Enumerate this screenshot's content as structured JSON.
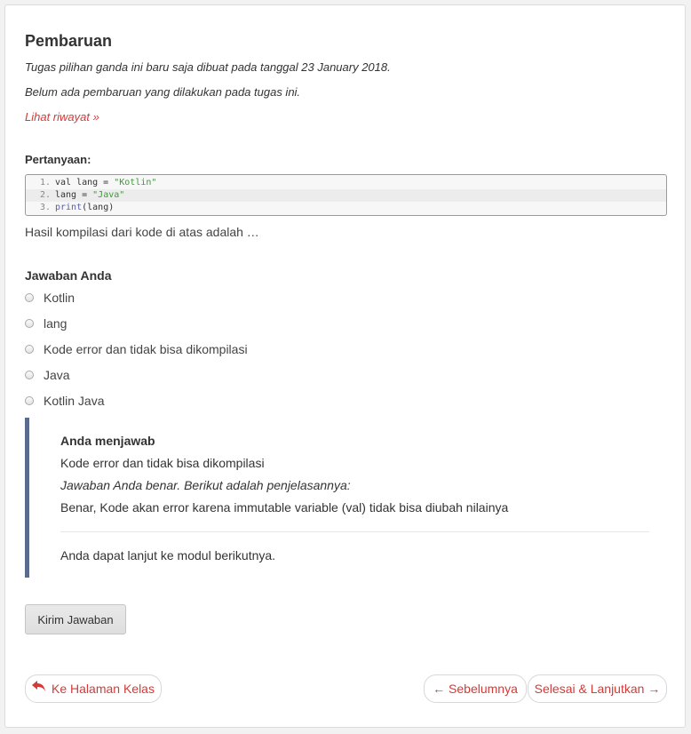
{
  "update": {
    "title": "Pembaruan",
    "created_note": "Tugas pilihan ganda ini baru saja dibuat pada tanggal 23 January 2018.",
    "no_updates_note": "Belum ada pembaruan yang dilakukan pada tugas ini.",
    "history_link": "Lihat riwayat »"
  },
  "question": {
    "label": "Pertanyaan:",
    "code": [
      {
        "num": "1.",
        "prefix": "val lang = ",
        "string": "\"Kotlin\""
      },
      {
        "num": "2.",
        "prefix": "lang = ",
        "string": "\"Java\""
      },
      {
        "num": "3.",
        "fn": "print",
        "rest": "(lang)"
      }
    ],
    "prompt": "Hasil kompilasi dari kode di atas adalah …"
  },
  "answers": {
    "label": "Jawaban Anda",
    "options": [
      "Kotlin",
      "lang",
      "Kode error dan tidak bisa dikompilasi",
      "Java",
      "Kotlin Java"
    ]
  },
  "feedback": {
    "title": "Anda menjawab",
    "answer": "Kode error dan tidak bisa dikompilasi",
    "correct_note": "Jawaban Anda benar. Berikut adalah penjelasannya:",
    "explanation": "Benar, Kode akan error karena immutable variable (val) tidak bisa diubah nilainya",
    "next_note": "Anda dapat lanjut ke modul berikutnya."
  },
  "actions": {
    "submit": "Kirim Jawaban",
    "back_to_class": "Ke Halaman Kelas",
    "previous": "← Sebelumnya",
    "finish_next": "Selesai & Lanjutkan →"
  },
  "colors": {
    "accent": "#d23b38",
    "feedback_border": "#5b6b8f"
  }
}
